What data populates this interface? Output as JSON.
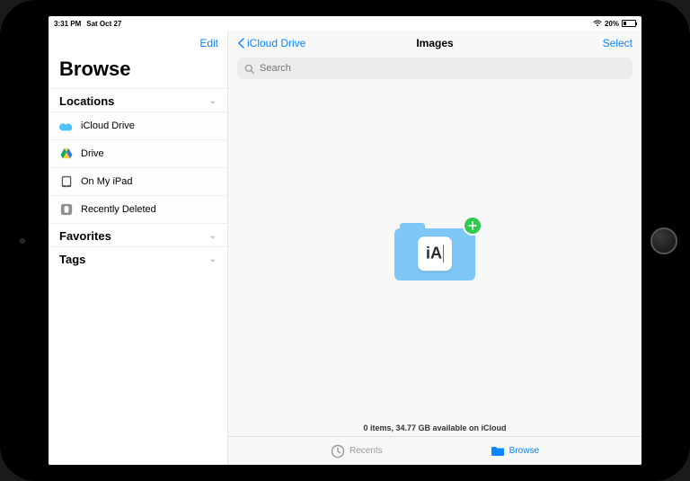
{
  "status": {
    "time": "3:31 PM",
    "date": "Sat Oct 27",
    "battery_pct": "20%"
  },
  "sidebar": {
    "edit_label": "Edit",
    "title": "Browse",
    "sections": {
      "locations": {
        "label": "Locations"
      },
      "favorites": {
        "label": "Favorites"
      },
      "tags": {
        "label": "Tags"
      }
    },
    "locations": [
      {
        "label": "iCloud Drive"
      },
      {
        "label": "Drive"
      },
      {
        "label": "On My iPad"
      },
      {
        "label": "Recently Deleted"
      }
    ]
  },
  "content": {
    "back_label": "iCloud Drive",
    "title": "Images",
    "select_label": "Select",
    "search_placeholder": "Search",
    "footer": "0 items, 34.77 GB available on iCloud",
    "drop_icon_text": "iA"
  },
  "tabbar": {
    "recents": "Recents",
    "browse": "Browse"
  }
}
